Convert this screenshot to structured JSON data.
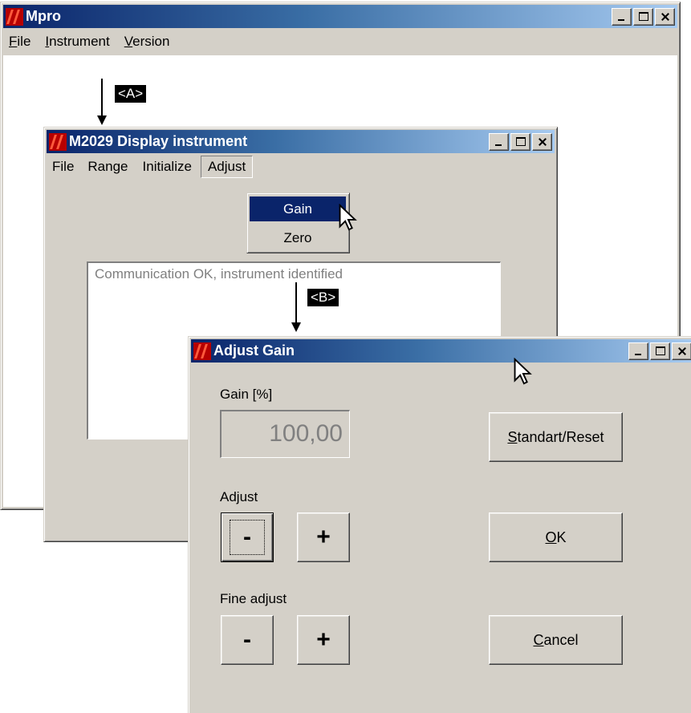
{
  "mpro_window": {
    "title": "Mpro",
    "menu": [
      "File",
      "Instrument",
      "Version"
    ]
  },
  "callout_a": "<A>",
  "callout_b": "<B>",
  "display_window": {
    "title": "M2029 Display instrument",
    "menu": [
      "File",
      "Range",
      "Initialize",
      "Adjust"
    ],
    "adjust_dropdown": [
      "Gain",
      "Zero"
    ],
    "status_text": "Communication OK, instrument identified"
  },
  "adjust_gain_dialog": {
    "title": "Adjust Gain",
    "gain_label": "Gain [%]",
    "gain_value": "100,00",
    "standart_reset_button": "Standart/Reset",
    "adjust_label": "Adjust",
    "minus": "-",
    "plus": "+",
    "ok_button": "OK",
    "fine_adjust_label": "Fine adjust",
    "cancel_button": "Cancel"
  },
  "icons": [
    "mpro-app-icon",
    "minimize-icon",
    "maximize-icon",
    "close-icon",
    "mouse-pointer-icon"
  ]
}
